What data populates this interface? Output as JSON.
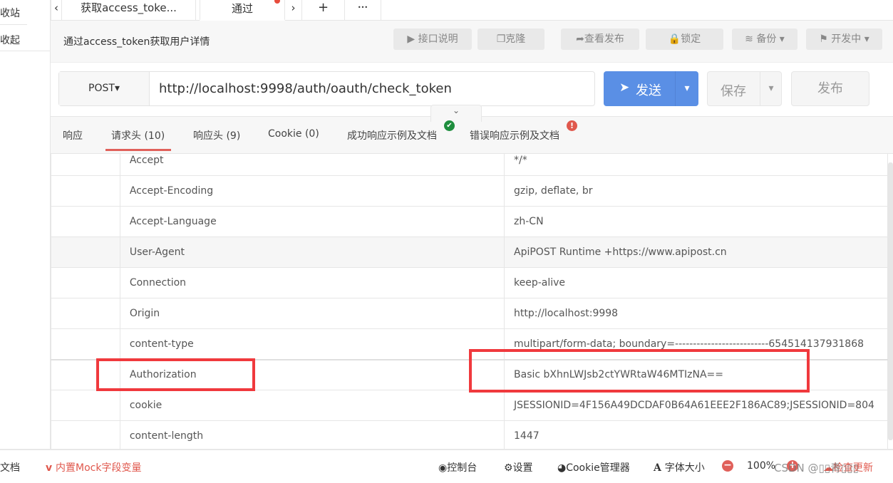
{
  "sidebar": {
    "items": [
      "收站",
      "收起"
    ]
  },
  "tabs": {
    "prev": "‹",
    "items": [
      "获取access_toke...",
      "通过access_toke..."
    ],
    "next": "›",
    "add": "+",
    "more": "•••",
    "active_dot_color": "#e74c3c"
  },
  "title": {
    "text": "通过access_token获取用户详情",
    "buttons": [
      "接口说明",
      "克隆",
      "查看发布",
      "锁定",
      "备份",
      "开发中"
    ]
  },
  "request": {
    "method": "POST",
    "url": "http://localhost:9998/auth/oauth/check_token",
    "send": "发送",
    "save": "保存",
    "publish": "发布",
    "accent": "#5a8fe5"
  },
  "response_tabs": {
    "items": [
      "响应",
      "请求头 (10)",
      "响应头 (9)",
      "Cookie (0)",
      "成功响应示例及文档",
      "错误响应示例及文档"
    ],
    "active": 1,
    "active_color": "#e0605a"
  },
  "headers": [
    {
      "name": "Accept",
      "value": "*/*"
    },
    {
      "name": "Accept-Encoding",
      "value": "gzip, deflate, br"
    },
    {
      "name": "Accept-Language",
      "value": "zh-CN"
    },
    {
      "name": "User-Agent",
      "value": "ApiPOST Runtime +https://www.apipost.cn"
    },
    {
      "name": "Connection",
      "value": "keep-alive"
    },
    {
      "name": "Origin",
      "value": "http://localhost:9998"
    },
    {
      "name": "content-type",
      "value": "multipart/form-data; boundary=--------------------------654514137931868"
    },
    {
      "name": "Authorization",
      "value": "Basic bXhnLWJsb2ctYWRtaW46MTIzNA=="
    },
    {
      "name": "cookie",
      "value": "JSESSIONID=4F156A49DCDAF0B64A61EEE2F186AC89;JSESSIONID=804"
    },
    {
      "name": "content-length",
      "value": "1447"
    }
  ],
  "footer": {
    "doc": "文档",
    "mock": "内置Mock字段变量",
    "console": "控制台",
    "settings": "设置",
    "cookie": "Cookie管理器",
    "font": "字体大小",
    "zoom": "100%",
    "update": "检查更新",
    "watermark": "CSDN @▯▯青▯▯▯"
  }
}
